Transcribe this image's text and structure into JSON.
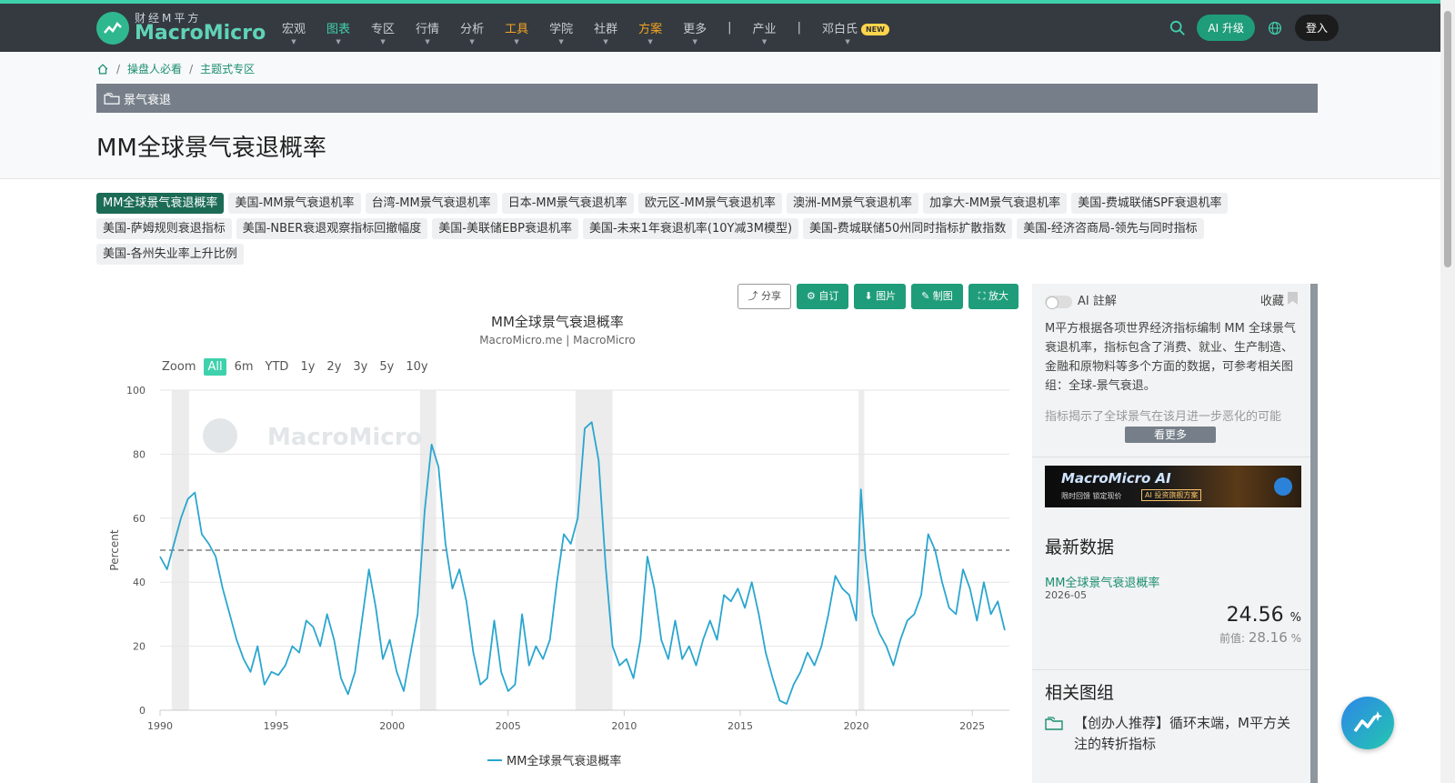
{
  "brand": {
    "cn": "财经M平方",
    "en": "MacroMicro"
  },
  "nav": {
    "items": [
      {
        "label": "宏观",
        "style": "normal"
      },
      {
        "label": "图表",
        "style": "active"
      },
      {
        "label": "专区",
        "style": "normal"
      },
      {
        "label": "行情",
        "style": "normal"
      },
      {
        "label": "分析",
        "style": "normal"
      },
      {
        "label": "工具",
        "style": "orange"
      },
      {
        "label": "学院",
        "style": "normal"
      },
      {
        "label": "社群",
        "style": "normal"
      },
      {
        "label": "方案",
        "style": "orange"
      }
    ],
    "more": "更多",
    "sep": "|",
    "industry": "产业",
    "user": "邓白氏",
    "new_badge": "NEW",
    "ai_upgrade": "AI 升级",
    "login": "登入"
  },
  "breadcrumb": {
    "home_icon": "home-icon",
    "items": [
      "操盘人必看",
      "主题式专区"
    ]
  },
  "section": {
    "label": "景气衰退",
    "icon": "folder-icon"
  },
  "page_title": "MM全球景气衰退概率",
  "tags": [
    "MM全球景气衰退概率",
    "美国-MM景气衰退机率",
    "台湾-MM景气衰退机率",
    "日本-MM景气衰退机率",
    "欧元区-MM景气衰退机率",
    "澳洲-MM景气衰退机率",
    "加拿大-MM景气衰退机率",
    "美国-费城联储SPF衰退机率",
    "美国-萨姆规则衰退指标",
    "美国-NBER衰退观察指标回撤幅度",
    "美国-美联储EBP衰退机率",
    "美国-未来1年衰退机率(10Y减3M模型)",
    "美国-费城联储50州同时指标扩散指数",
    "美国-经济咨商局-领先与同时指标",
    "美国-各州失业率上升比例"
  ],
  "toolbar": {
    "share": "分享",
    "subscribe": "自订",
    "image": "图片",
    "draw": "制图",
    "zoom": "放大"
  },
  "range": {
    "label": "Zoom",
    "options": [
      "All",
      "6m",
      "YTD",
      "1y",
      "2y",
      "3y",
      "5y",
      "10y"
    ],
    "selected": "All"
  },
  "chart_data": {
    "type": "line",
    "title": "MM全球景气衰退概率",
    "subtitle": "MacroMicro.me | MacroMicro",
    "ylabel": "Percent",
    "ylim": [
      0,
      100
    ],
    "yticks": [
      0,
      20,
      40,
      60,
      80,
      100
    ],
    "xlim": [
      1990,
      2026.6
    ],
    "xticks": [
      1990,
      1995,
      2000,
      2005,
      2010,
      2015,
      2020,
      2025
    ],
    "threshold": 50,
    "watermark": "MacroMicro",
    "legend_position": "bottom",
    "recessions": [
      [
        1990.5,
        1991.25
      ],
      [
        2001.2,
        2001.9
      ],
      [
        2007.9,
        2009.5
      ],
      [
        2020.1,
        2020.35
      ]
    ],
    "series": [
      {
        "name": "MM全球景气衰退概率",
        "color": "#2aa6cf",
        "x": [
          1990.0,
          1990.3,
          1990.6,
          1990.9,
          1991.2,
          1991.5,
          1991.8,
          1992.1,
          1992.4,
          1992.7,
          1993.0,
          1993.3,
          1993.6,
          1993.9,
          1994.2,
          1994.5,
          1994.8,
          1995.1,
          1995.4,
          1995.7,
          1996.0,
          1996.3,
          1996.6,
          1996.9,
          1997.2,
          1997.5,
          1997.8,
          1998.1,
          1998.4,
          1998.7,
          1999.0,
          1999.3,
          1999.6,
          1999.9,
          2000.2,
          2000.5,
          2000.8,
          2001.1,
          2001.4,
          2001.7,
          2002.0,
          2002.3,
          2002.6,
          2002.9,
          2003.2,
          2003.5,
          2003.8,
          2004.1,
          2004.4,
          2004.7,
          2005.0,
          2005.3,
          2005.6,
          2005.9,
          2006.2,
          2006.5,
          2006.8,
          2007.1,
          2007.4,
          2007.7,
          2008.0,
          2008.3,
          2008.6,
          2008.9,
          2009.2,
          2009.5,
          2009.8,
          2010.1,
          2010.4,
          2010.7,
          2011.0,
          2011.3,
          2011.6,
          2011.9,
          2012.2,
          2012.5,
          2012.8,
          2013.1,
          2013.4,
          2013.7,
          2014.0,
          2014.3,
          2014.6,
          2014.9,
          2015.2,
          2015.5,
          2015.8,
          2016.1,
          2016.4,
          2016.7,
          2017.0,
          2017.3,
          2017.6,
          2017.9,
          2018.2,
          2018.5,
          2018.8,
          2019.1,
          2019.4,
          2019.7,
          2020.0,
          2020.2,
          2020.4,
          2020.7,
          2021.0,
          2021.3,
          2021.6,
          2021.9,
          2022.2,
          2022.5,
          2022.8,
          2023.1,
          2023.4,
          2023.7,
          2024.0,
          2024.3,
          2024.6,
          2024.9,
          2025.2,
          2025.5,
          2025.8,
          2026.1,
          2026.4
        ],
        "y": [
          48,
          44,
          52,
          60,
          66,
          68,
          55,
          52,
          48,
          38,
          30,
          22,
          16,
          12,
          20,
          8,
          12,
          11,
          14,
          20,
          18,
          28,
          26,
          20,
          30,
          22,
          10,
          5,
          12,
          28,
          44,
          32,
          16,
          22,
          12,
          6,
          18,
          30,
          62,
          83,
          76,
          52,
          38,
          44,
          34,
          18,
          8,
          10,
          28,
          12,
          6,
          8,
          30,
          14,
          20,
          16,
          22,
          40,
          55,
          52,
          60,
          88,
          90,
          78,
          45,
          20,
          14,
          16,
          10,
          22,
          48,
          38,
          22,
          16,
          28,
          16,
          20,
          14,
          22,
          28,
          22,
          36,
          34,
          38,
          32,
          40,
          30,
          18,
          10,
          3,
          2,
          8,
          12,
          18,
          14,
          20,
          30,
          42,
          38,
          36,
          28,
          69,
          48,
          30,
          24,
          20,
          14,
          22,
          28,
          30,
          36,
          55,
          50,
          40,
          32,
          30,
          44,
          38,
          28,
          40,
          30,
          34,
          25
        ]
      }
    ]
  },
  "side": {
    "ai_label": "AI 註解",
    "favorite": "收藏",
    "desc": "M平方根据各项世界经济指标编制 MM 全球景气衰退机率，指标包含了消费、就业、生产制造、金融和原物料等多个方面的数据，可参考相关图组：全球-景气衰退。",
    "desc2": "指标揭示了全球景气在该月进一步恶化的可能",
    "more": "看更多",
    "banner": {
      "title": "MacroMicro AI",
      "sub": "限时回馈 锁定现价",
      "tag": "AI 投资旗舰方案"
    },
    "latest_title": "最新数据",
    "latest_name": "MM全球景气衰退概率",
    "latest_date": "2026-05",
    "latest_value": "24.56",
    "latest_unit": "%",
    "prev_label": "前值:",
    "prev_value": "28.16",
    "prev_unit": "%",
    "related_title": "相关图组",
    "related_item": "【创办人推荐】循环末端，M平方关注的转折指标"
  }
}
